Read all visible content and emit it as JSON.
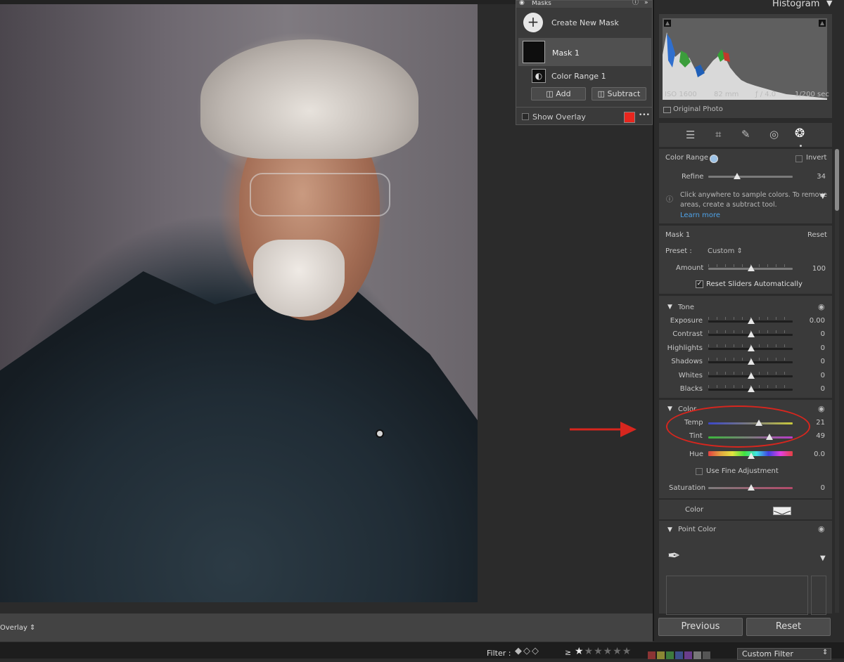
{
  "masks": {
    "header": "Masks",
    "create_new": "Create New Mask",
    "mask_name": "Mask 1",
    "component": "Color Range 1",
    "add": "Add",
    "subtract": "Subtract",
    "show_overlay": "Show Overlay",
    "overlay_color": "#e8261e",
    "more": "•••"
  },
  "histogram": {
    "title": "Histogram",
    "iso": "ISO 1600",
    "focal": "82 mm",
    "aperture": "ƒ / 4.0",
    "shutter": "1/200 sec",
    "original_photo": "Original Photo"
  },
  "color_range": {
    "label": "Color Range",
    "invert": "Invert",
    "refine_label": "Refine",
    "refine_value": "34",
    "refine_fraction": 0.34,
    "info": "Click anywhere to sample colors. To remove areas, create a subtract tool.",
    "info_line1": "Click anywhere to sample colors. To remove",
    "info_line2": "areas, create a subtract tool.",
    "learn_more": "Learn more"
  },
  "mask_settings": {
    "title": "Mask 1",
    "reset": "Reset",
    "preset_label": "Preset :",
    "preset_value": "Custom",
    "amount_label": "Amount",
    "amount_value": "100",
    "amount_fraction": 0.5,
    "reset_sliders": "Reset Sliders Automatically"
  },
  "tone": {
    "title": "Tone",
    "sliders": [
      {
        "label": "Exposure",
        "value": "0.00"
      },
      {
        "label": "Contrast",
        "value": "0"
      },
      {
        "label": "Highlights",
        "value": "0"
      },
      {
        "label": "Shadows",
        "value": "0"
      },
      {
        "label": "Whites",
        "value": "0"
      },
      {
        "label": "Blacks",
        "value": "0"
      }
    ]
  },
  "color": {
    "title": "Color",
    "temp_label": "Temp",
    "temp_value": "21",
    "tint_label": "Tint",
    "tint_value": "49",
    "hue_label": "Hue",
    "hue_value": "0.0",
    "fine_adjust": "Use Fine Adjustment",
    "saturation_label": "Saturation",
    "saturation_value": "0",
    "color_label": "Color"
  },
  "point_color": {
    "title": "Point Color"
  },
  "buttons": {
    "previous": "Previous",
    "reset": "Reset"
  },
  "bottom": {
    "overlay": "Overlay"
  },
  "filter": {
    "label": "Filter :",
    "custom": "Custom Filter",
    "gte": "≥"
  },
  "annotation_color": "#d7261e"
}
